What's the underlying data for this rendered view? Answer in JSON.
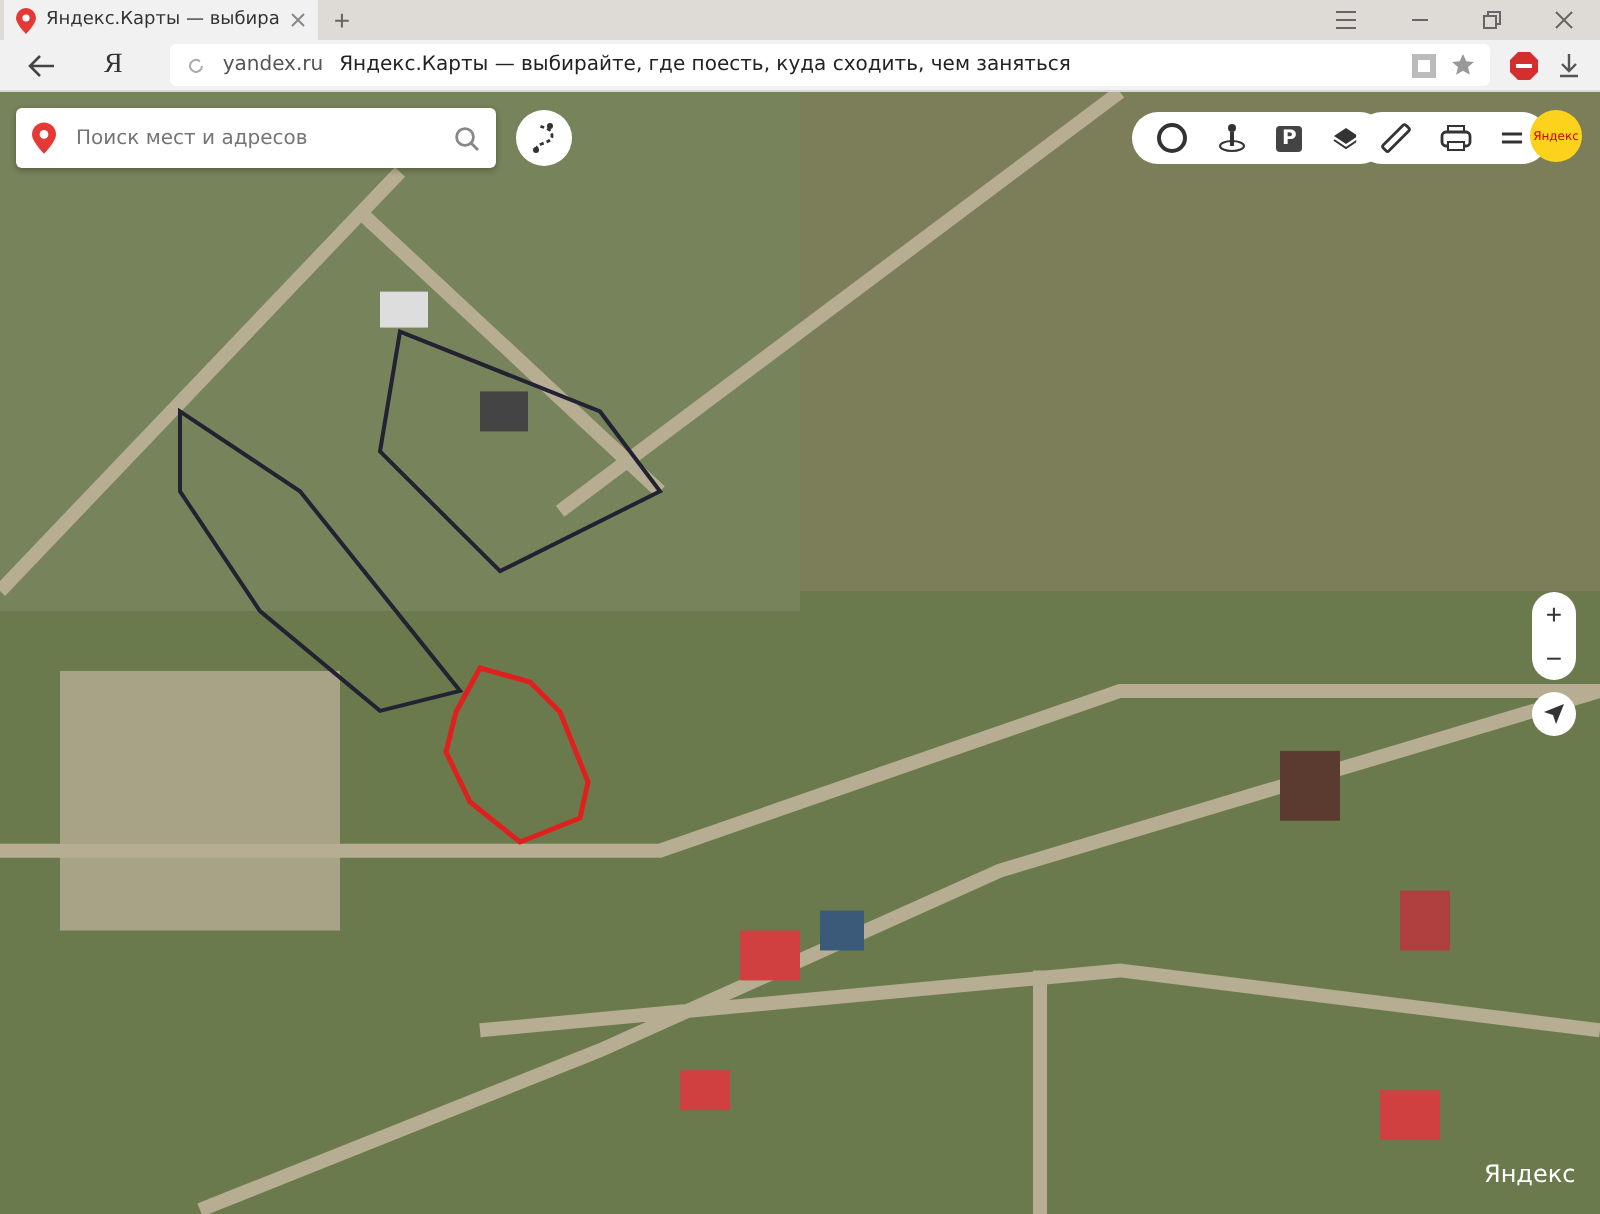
{
  "browser": {
    "tab": {
      "title": "Яндекс.Карты — выбира",
      "selected": true
    },
    "new_tab": "+",
    "home_logo": "Я",
    "address": {
      "domain": "yandex.ru",
      "page_title": "Яндекс.Карты — выбирайте, где поесть, куда сходить, чем заняться"
    }
  },
  "map": {
    "search": {
      "placeholder": "Поиск мест и адресов"
    },
    "parking_label": "P",
    "logo": "Яндекс",
    "zoom_in": "+",
    "zoom_out": "−",
    "attribution": "Яндекс"
  }
}
